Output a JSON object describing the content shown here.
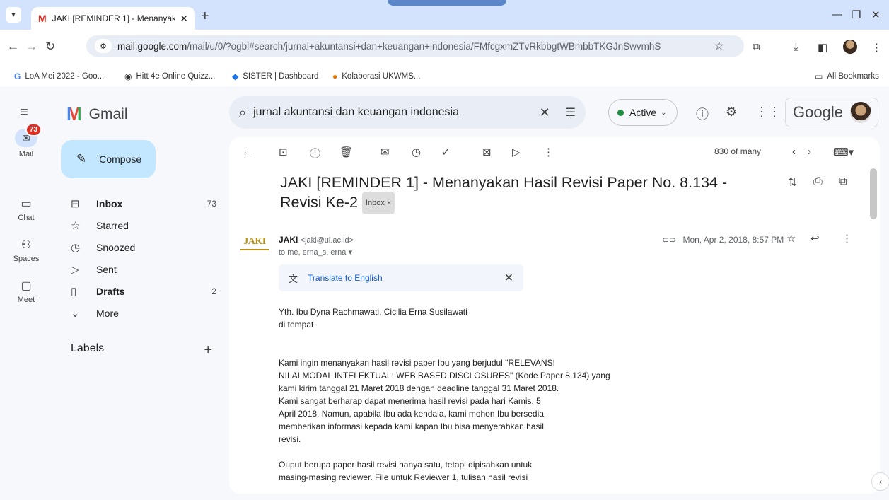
{
  "browser": {
    "tab_title": "JAKI [REMINDER 1] - Menanyak",
    "url_host": "mail.google.com",
    "url_path": "/mail/u/0/?ogbl#search/jurnal+akuntansi+dan+keuangan+indonesia/FMfcgxmZTvRkbbgtWBmbbTKGJnSwvmhS",
    "bookmarks": [
      "LoA Mei 2022 - Goo...",
      "Hitt 4e Online Quizz...",
      "SISTER | Dashboard",
      "Kolaborasi UKWMS..."
    ],
    "all_bookmarks": "All Bookmarks"
  },
  "rail": {
    "mail": "Mail",
    "mail_badge": "73",
    "chat": "Chat",
    "spaces": "Spaces",
    "meet": "Meet"
  },
  "app": {
    "name": "Gmail",
    "compose": "Compose",
    "labels_heading": "Labels"
  },
  "nav": [
    {
      "label": "Inbox",
      "count": "73",
      "icon": "inbox-icon"
    },
    {
      "label": "Starred",
      "count": "",
      "icon": "star-icon"
    },
    {
      "label": "Snoozed",
      "count": "",
      "icon": "clock-icon"
    },
    {
      "label": "Sent",
      "count": "",
      "icon": "send-icon"
    },
    {
      "label": "Drafts",
      "count": "2",
      "icon": "draft-icon"
    },
    {
      "label": "More",
      "count": "",
      "icon": "chevron-down-icon"
    }
  ],
  "header": {
    "search_value": "jurnal akuntansi dan keuangan indonesia",
    "status": "Active",
    "brand": "Google"
  },
  "toolbar": {
    "pager": "830 of many"
  },
  "email": {
    "subject": "JAKI [REMINDER 1] - Menanyakan Hasil Revisi Paper No. 8.134 - Revisi Ke-2",
    "label_chip": "Inbox ×",
    "sender_logo": "JAKI",
    "sender_name": "JAKI",
    "sender_address": "<jaki@ui.ac.id>",
    "recipients": "to me, erna_s, erna ▾",
    "date": "Mon, Apr 2, 2018, 8:57 PM",
    "translate": "Translate to English",
    "greeting": [
      "Yth. Ibu Dyna Rachmawati, Cicilia Erna Susilawati",
      "di tempat"
    ],
    "para1": [
      "Kami ingin menanyakan hasil revisi paper Ibu yang berjudul \"RELEVANSI",
      "NILAI MODAL INTELEKTUAL: WEB BASED DISCLOSURES\" (Kode Paper 8.134) yang",
      "kami kirim tanggal 21 Maret 2018 dengan deadline tanggal 31 Maret 2018.",
      "Kami sangat berharap dapat menerima hasil revisi pada hari Kamis, 5",
      "April 2018. Namun, apabila Ibu ada kendala, kami mohon Ibu bersedia",
      "memberikan informasi kepada kami kapan Ibu bisa menyerahkan hasil",
      "revisi."
    ],
    "para2": [
      "Ouput berupa paper hasil revisi hanya satu, tetapi dipisahkan untuk",
      "masing-masing reviewer. File untuk Reviewer 1, tulisan hasil revisi"
    ]
  },
  "colors": {
    "accent": "#0b57d0",
    "badge": "#d93025",
    "compose_bg": "#c2e7ff",
    "active_dot": "#1e8e3e"
  }
}
